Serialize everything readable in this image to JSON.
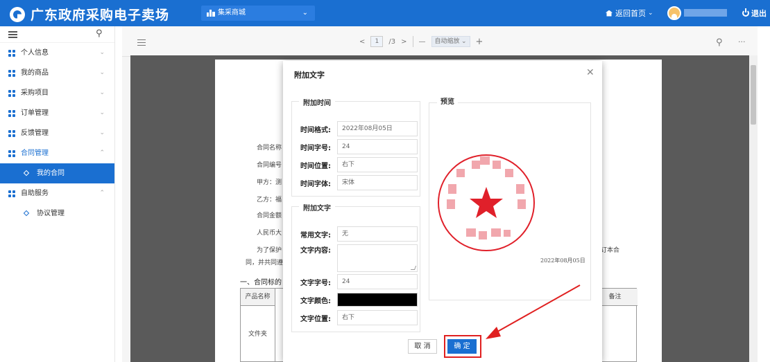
{
  "app": {
    "title": "广东政府采购电子卖场"
  },
  "header": {
    "mall_select": "集采商城",
    "home_link": "返回首页",
    "logout": "退出"
  },
  "sidebar": {
    "items": [
      {
        "label": "个人信息"
      },
      {
        "label": "我的商品"
      },
      {
        "label": "采购项目"
      },
      {
        "label": "订单管理"
      },
      {
        "label": "反馈管理"
      },
      {
        "label": "合同管理"
      },
      {
        "label": "我的合同",
        "active": true
      },
      {
        "label": "自助服务"
      },
      {
        "label": "协议管理"
      }
    ]
  },
  "viewer": {
    "page_current": "1",
    "page_total": "/3",
    "zoom": "自动缩放",
    "doc_lines": [
      "合同名称",
      "合同编号",
      "甲方：测",
      "乙方：福",
      "合同金额",
      "人民币大",
      "为了保护",
      "同，并共同遵",
      "订本合"
    ],
    "section_heading": "一、合同标的",
    "table": {
      "col_product": "产品名称",
      "col_note": "备注",
      "cell_product": "文件夹"
    }
  },
  "modal": {
    "title": "附加文字",
    "time_section": "附加时间",
    "time_format_label": "时间格式:",
    "time_format_value": "2022年08月05日",
    "time_size_label": "时间字号:",
    "time_size_value": "24",
    "time_position_label": "时间位置:",
    "time_position_value": "右下",
    "time_font_label": "时间字体:",
    "time_font_value": "宋体",
    "text_section": "附加文字",
    "common_text_label": "常用文字:",
    "common_text_value": "无",
    "text_content_label": "文字内容:",
    "text_size_label": "文字字号:",
    "text_size_value": "24",
    "text_color_label": "文字颜色:",
    "text_color_value": "#000000",
    "text_position_label": "文字位置:",
    "text_position_value": "右下",
    "preview_section": "预览",
    "preview_date": "2022年08月05日",
    "cancel": "取 消",
    "confirm": "确 定"
  },
  "colors": {
    "brand": "#1a6fd1",
    "annotation": "#e02020",
    "seal": "#e0202a"
  }
}
